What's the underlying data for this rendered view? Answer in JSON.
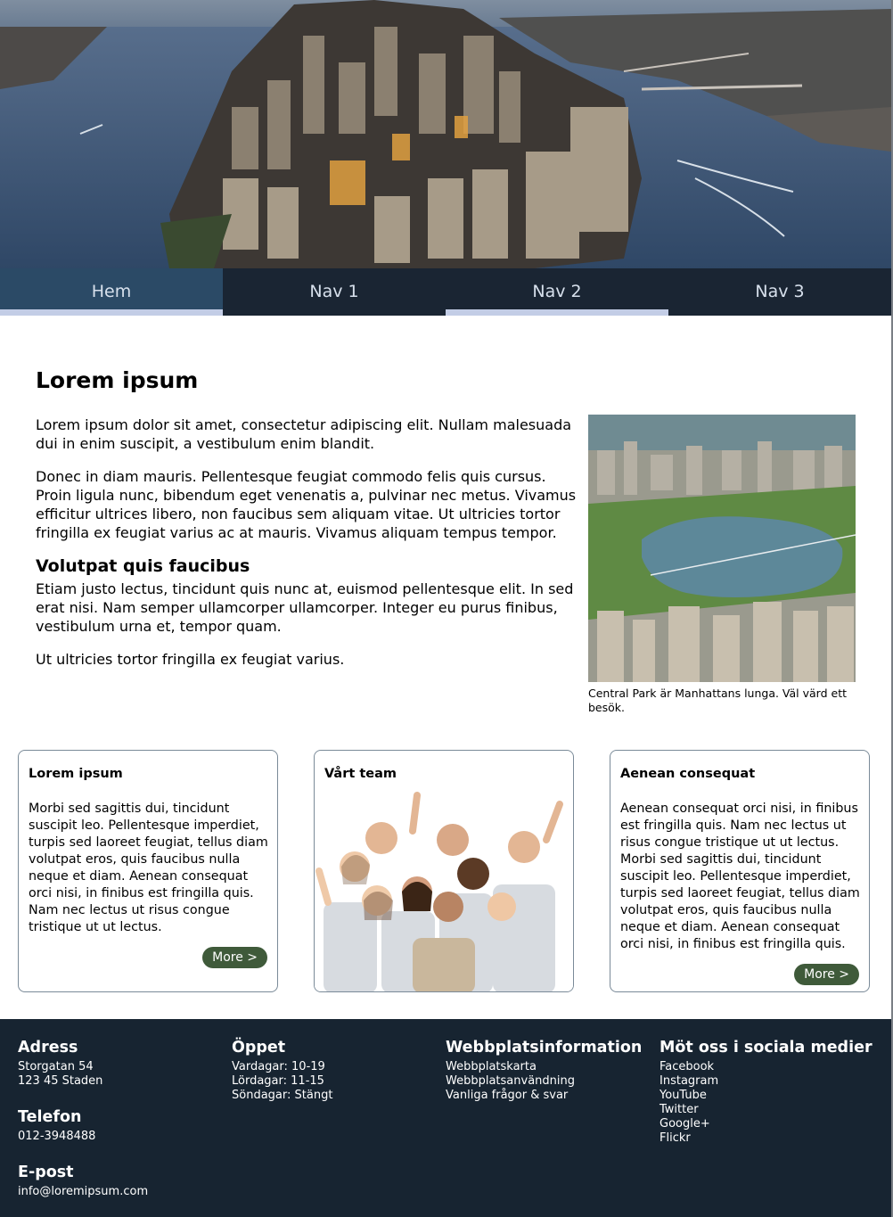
{
  "hero": {
    "image": "aerial-city-manhattan"
  },
  "nav": {
    "items": [
      {
        "label": "Hem"
      },
      {
        "label": "Nav 1"
      },
      {
        "label": "Nav 2"
      },
      {
        "label": "Nav 3"
      }
    ]
  },
  "main": {
    "title": "Lorem ipsum",
    "p1": "Lorem ipsum dolor sit amet, consectetur adipiscing elit. Nullam malesuada dui in enim suscipit, a vestibulum enim blandit.",
    "p2": "Donec in diam mauris. Pellentesque feugiat commodo felis quis cursus. Proin ligula nunc, bibendum eget venenatis a, pulvinar nec metus. Vivamus efficitur ultrices libero, non faucibus sem aliquam vitae. Ut ultricies tortor fringilla ex feugiat varius ac at mauris. Vivamus aliquam tempus tempor.",
    "subtitle": "Volutpat quis faucibus",
    "p3": "Etiam justo lectus, tincidunt quis nunc at, euismod pellentesque elit. In sed erat nisi. Nam semper ullamcorper ullamcorper. Integer eu purus finibus, vestibulum urna et, tempor quam.",
    "p4": "Ut ultricies tortor fringilla ex feugiat varius."
  },
  "figure": {
    "image": "central-park-aerial",
    "caption": "Central Park är Manhattans lunga. Väl värd ett besök."
  },
  "cards": [
    {
      "title": "Lorem ipsum",
      "body": "Morbi sed sagittis dui, tincidunt suscipit leo. Pellentesque imperdiet, turpis sed laoreet feugiat, tellus diam volutpat eros, quis faucibus nulla neque et diam. Aenean consequat orci nisi, in finibus est fringilla quis. Nam nec lectus ut risus congue tristique ut ut lectus.",
      "button": "More >"
    },
    {
      "title": "Vårt team",
      "image": "team-group-photo"
    },
    {
      "title": "Aenean consequat",
      "body": "Aenean consequat orci nisi, in finibus est fringilla quis. Nam nec lectus ut risus congue tristique ut ut lectus. Morbi sed sagittis dui, tincidunt suscipit leo. Pellentesque imperdiet, turpis sed laoreet feugiat, tellus diam volutpat eros, quis faucibus nulla neque et diam. Aenean consequat orci nisi, in finibus est fringilla quis.",
      "button": "More >"
    }
  ],
  "footer": {
    "address": {
      "heading": "Adress",
      "lines": [
        "Storgatan 54",
        "123 45 Staden"
      ]
    },
    "phone": {
      "heading": "Telefon",
      "value": "012-3948488"
    },
    "email": {
      "heading": "E-post",
      "value": "info@loremipsum.com"
    },
    "hours": {
      "heading": "Öppet",
      "lines": [
        "Vardagar: 10-19",
        "Lördagar: 11-15",
        "Söndagar: Stängt"
      ]
    },
    "siteinfo": {
      "heading": "Webbplatsinformation",
      "links": [
        "Webbplatskarta",
        "Webbplatsanvändning",
        "Vanliga frågor & svar"
      ]
    },
    "social": {
      "heading": "Möt oss i sociala medier",
      "links": [
        "Facebook",
        "Instagram",
        "YouTube",
        "Twitter",
        "Google+",
        "Flickr"
      ]
    }
  }
}
